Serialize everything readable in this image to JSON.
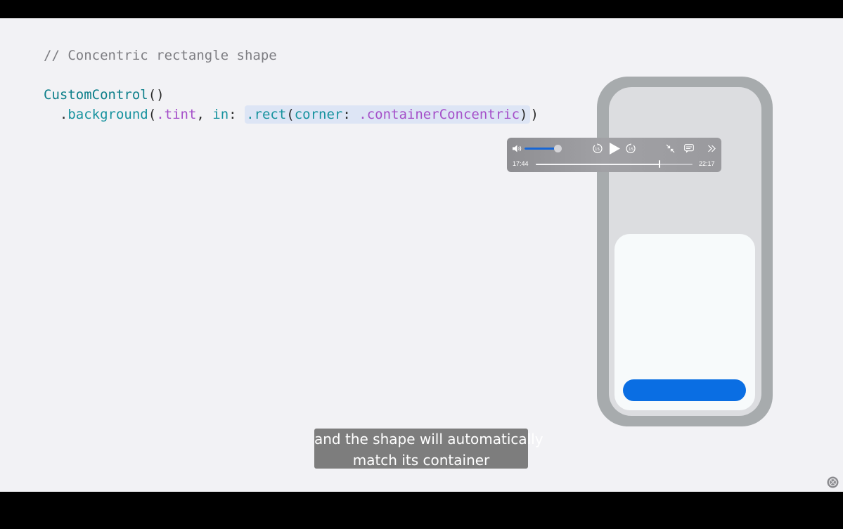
{
  "code": {
    "comment": "// Concentric rectangle shape",
    "line1": {
      "type": "CustomControl",
      "punct": "()"
    },
    "line2": {
      "dot1": ".",
      "method": "background",
      "open": "(",
      "member1": ".tint",
      "comma": ", ",
      "label_in": "in",
      "colon": ": ",
      "highlight": {
        "method": ".rect",
        "open": "(",
        "label_corner": "corner",
        "colon": ": ",
        "member": ".containerConcentric",
        "close": ")"
      },
      "close": ")"
    }
  },
  "player": {
    "icons": [
      "volume-icon",
      "skip-back-15-icon",
      "play-icon",
      "skip-forward-15-icon",
      "exit-fullscreen-icon",
      "captions-icon",
      "more-icon"
    ],
    "elapsed": "17:44",
    "total": "22:17",
    "volume_level": 0.92,
    "progress": 0.79,
    "skip_seconds": "15"
  },
  "subtitle": {
    "line1": "and the shape will automatically",
    "line2": "match its container"
  },
  "colors": {
    "accent_button": "#0a6ee3",
    "volume_fill": "#1666d6",
    "slide_background": "#f2f2f5",
    "device_frame": "#a7abad"
  }
}
